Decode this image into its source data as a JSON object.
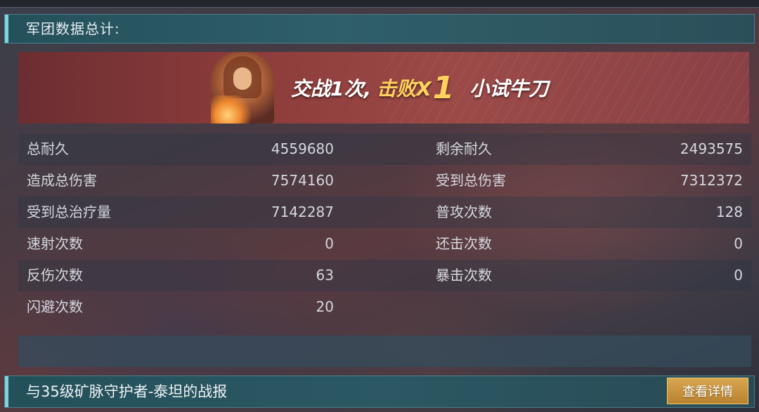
{
  "summary_title": "军团数据总计:",
  "banner": {
    "battles": "交战1次,",
    "defeat_label": "击败X",
    "defeat_count": "1",
    "rank_title": "小试牛刀"
  },
  "stats": [
    {
      "left_label": "总耐久",
      "left_value": "4559680",
      "right_label": "剩余耐久",
      "right_value": "2493575"
    },
    {
      "left_label": "造成总伤害",
      "left_value": "7574160",
      "right_label": "受到总伤害",
      "right_value": "7312372"
    },
    {
      "left_label": "受到总治疗量",
      "left_value": "7142287",
      "right_label": "普攻次数",
      "right_value": "128"
    },
    {
      "left_label": "速射次数",
      "left_value": "0",
      "right_label": "还击次数",
      "right_value": "0"
    },
    {
      "left_label": "反伤次数",
      "left_value": "63",
      "right_label": "暴击次数",
      "right_value": "0"
    },
    {
      "left_label": "闪避次数",
      "left_value": "20",
      "right_label": "",
      "right_value": ""
    }
  ],
  "footer": {
    "report_title": "与35级矿脉守护者-泰坦的战报",
    "detail_button": "查看详情"
  },
  "colors": {
    "header_accent": "#7fd3df",
    "highlight": "#ffd25e",
    "button": "#c8923e"
  }
}
